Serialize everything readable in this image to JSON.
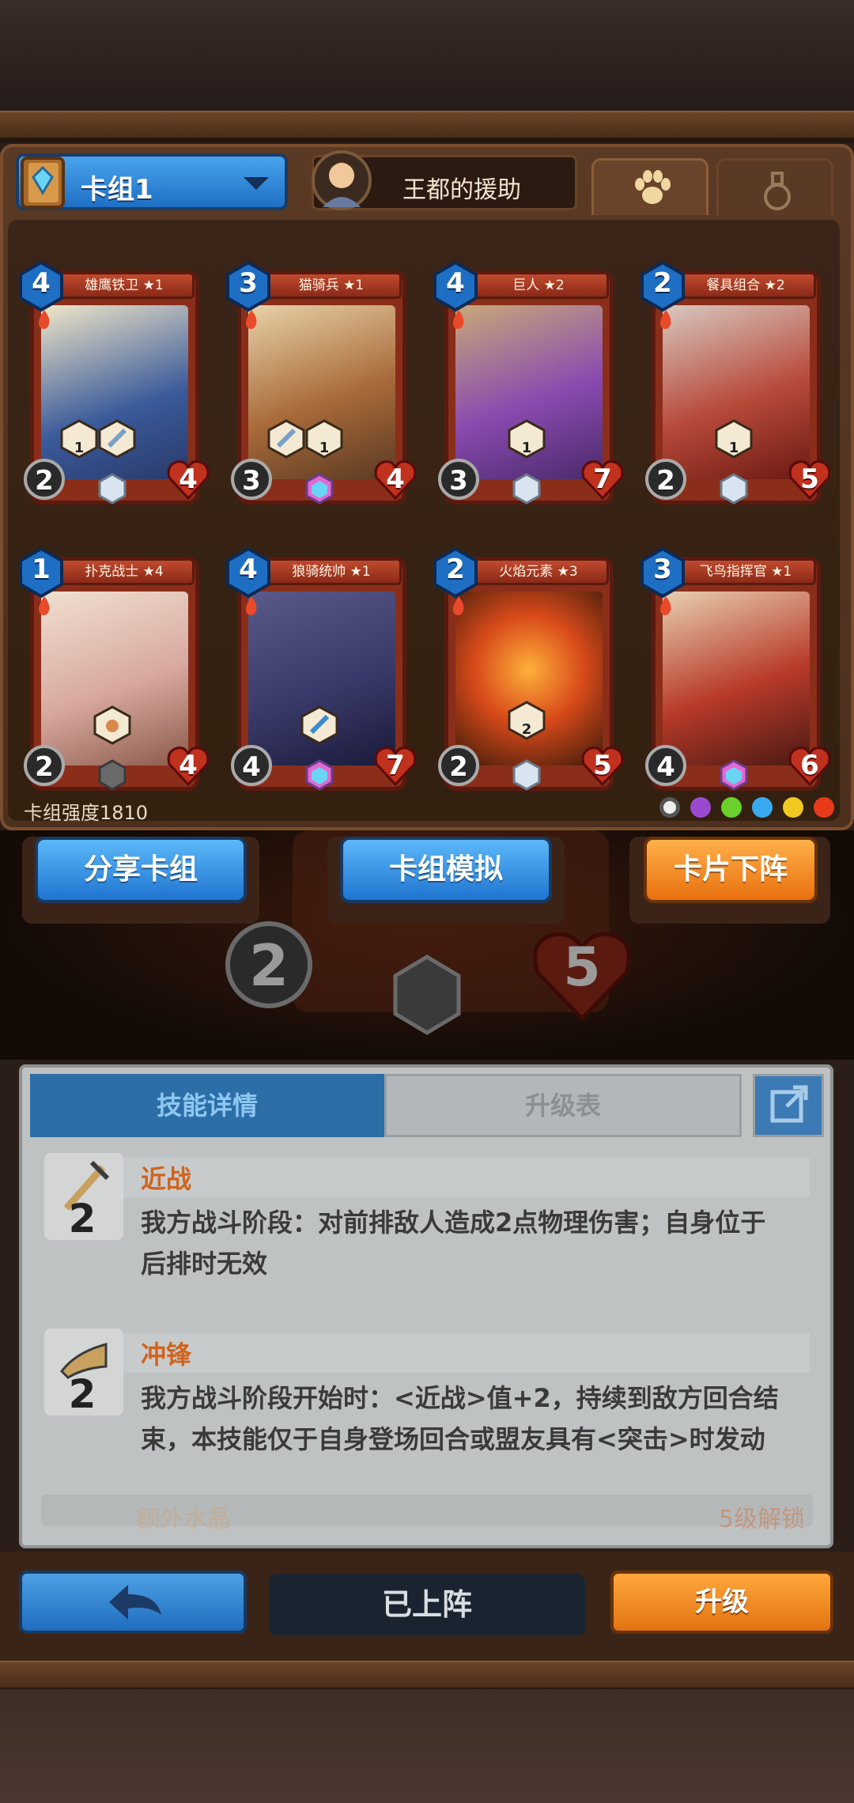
{
  "header": {
    "deck_label": "卡组1",
    "hero_label": "王都的援助"
  },
  "cards": [
    {
      "name": "雄鹰铁卫",
      "star": "★1",
      "cost": "4",
      "atk": "2",
      "hp": "4",
      "art_color": "#2a4d8a",
      "skill_levels": [
        "1",
        ""
      ]
    },
    {
      "name": "猫骑兵",
      "star": "★1",
      "cost": "3",
      "atk": "3",
      "hp": "4",
      "art_color": "#7a4a2a",
      "skill_levels": [
        "",
        "1"
      ]
    },
    {
      "name": "巨人",
      "star": "★2",
      "cost": "4",
      "atk": "3",
      "hp": "7",
      "art_color": "#7a3fa0",
      "skill_levels": [
        "1"
      ]
    },
    {
      "name": "餐具组合",
      "star": "★2",
      "cost": "2",
      "atk": "2",
      "hp": "5",
      "art_color": "#a83a2a",
      "skill_levels": [
        "1"
      ]
    },
    {
      "name": "扑克战士",
      "star": "★4",
      "cost": "1",
      "atk": "2",
      "hp": "4",
      "art_color": "#c9a08a",
      "skill_levels": [
        ""
      ]
    },
    {
      "name": "狼骑统帅",
      "star": "★1",
      "cost": "4",
      "atk": "4",
      "hp": "7",
      "art_color": "#3a3a6a",
      "skill_levels": [
        ""
      ]
    },
    {
      "name": "火焰元素",
      "star": "★3",
      "cost": "2",
      "atk": "2",
      "hp": "5",
      "art_color": "#c8421a",
      "skill_levels": [
        "2"
      ]
    },
    {
      "name": "飞鸟指挥官",
      "star": "★1",
      "cost": "3",
      "atk": "4",
      "hp": "6",
      "art_color": "#8a2a1a",
      "skill_levels": []
    }
  ],
  "deck_strength": "卡组强度1810",
  "buttons": {
    "share": "分享卡组",
    "simulate": "卡组模拟",
    "remove": "卡片下阵"
  },
  "detail": {
    "tab_skill": "技能详情",
    "tab_upgrade": "升级表",
    "skills": [
      {
        "title": "近战",
        "level": "2",
        "desc_line1": "我方战斗阶段：对前排敌人造成2点物理伤害；自身位于",
        "desc_line2": "后排时无效"
      },
      {
        "title": "冲锋",
        "level": "2",
        "desc_line1": "我方战斗阶段开始时：<近战>值+2，持续到敌方回合结",
        "desc_line2": "束，本技能仅于自身登场回合或盟友具有<突击>时发动"
      }
    ],
    "faded_title": "额外水晶",
    "faded_right": "5级解锁"
  },
  "bottom": {
    "deployed": "已上阵",
    "upgrade": "升级"
  },
  "colors": {
    "cost_blue": "#1e6fc4",
    "hp_red": "#c0311e",
    "orange": "#e8700e",
    "skill_title": "#d0641e"
  }
}
